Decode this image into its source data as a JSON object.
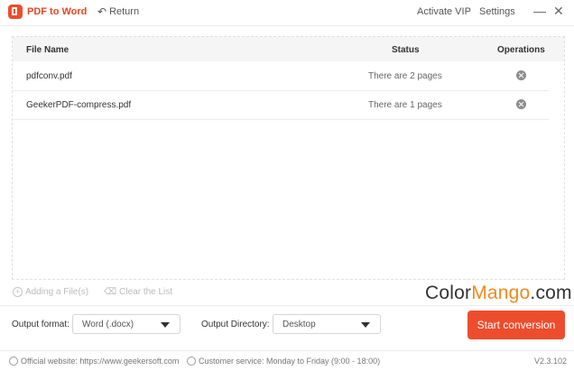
{
  "app": {
    "title": "PDF to Word",
    "return_label": "Return",
    "activate_vip": "Activate VIP",
    "settings": "Settings",
    "minimize_glyph": "—",
    "close_glyph": "✕"
  },
  "table": {
    "headers": {
      "file_name": "File Name",
      "status": "Status",
      "operations": "Operations"
    },
    "rows": [
      {
        "file_name": "pdfconv.pdf",
        "status": "There are 2 pages"
      },
      {
        "file_name": "GeekerPDF-compress.pdf",
        "status": "There are 1 pages"
      }
    ]
  },
  "actions": {
    "add_files": "Adding a File(s)",
    "clear_list": "Clear the List"
  },
  "watermark": {
    "part1": "Color",
    "part2": "Mango",
    "part3": ".com"
  },
  "output": {
    "format_label": "Output format:",
    "format_value": "Word (.docx)",
    "directory_label": "Output Directory:",
    "directory_value": "Desktop",
    "start_button": "Start conversion"
  },
  "footer": {
    "website": "Official website: https://www.geekersoft.com",
    "service": "Customer service: Monday to Friday (9:00 - 18:00)",
    "version": "V2.3.102"
  },
  "colors": {
    "accent": "#ee4d2d",
    "brand_text": "#e8451f"
  },
  "icons": {
    "logo": "app-logo-icon",
    "return": "return-arrow-icon",
    "delete": "delete-circle-icon",
    "add": "add-circle-icon",
    "clear": "eraser-icon",
    "website": "globe-icon",
    "service": "headset-icon"
  }
}
